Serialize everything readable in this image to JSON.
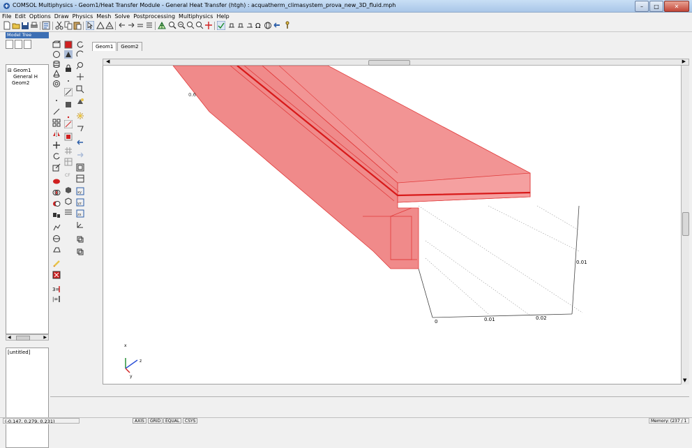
{
  "window": {
    "title": "COMSOL Multiphysics - Geom1/Heat Transfer Module - General Heat Transfer (htgh) : acquatherm_climasystem_prova_new_3D_fluid.mph"
  },
  "menu": [
    "File",
    "Edit",
    "Options",
    "Draw",
    "Physics",
    "Mesh",
    "Solve",
    "Postprocessing",
    "Multiphysics",
    "Help"
  ],
  "model_tree": {
    "title": "Model Tree",
    "nodes": [
      "Geom1",
      "General H",
      "Geom2"
    ],
    "properties_text": "[untitled]"
  },
  "tabs": [
    "Geom1",
    "Geom2"
  ],
  "axes": {
    "x_ticks": [
      "0",
      "0.01",
      "0.02"
    ],
    "z_tick": "0.01",
    "y_tick": "0.6",
    "triad": {
      "x": "x",
      "y": "y",
      "z": "z"
    }
  },
  "colors": {
    "geometry_fill": "#f08a8a",
    "geometry_edge": "#e03a3a",
    "accent": "#3d6fb4"
  },
  "statusbar": {
    "coords": "(-0.147, 0.279, 0.231)",
    "toggles": [
      "AXIS",
      "GRID",
      "EQUAL",
      "CSYS"
    ],
    "memory": "Memory: (237 / 1"
  }
}
